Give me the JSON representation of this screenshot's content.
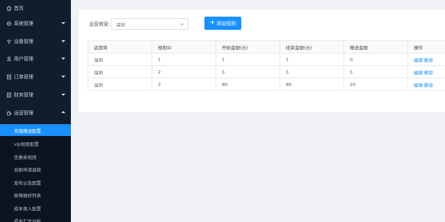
{
  "sidebar": {
    "items": [
      {
        "label": "首页",
        "icon": "home-icon",
        "caret": "none"
      },
      {
        "label": "系统管理",
        "icon": "gear-icon",
        "caret": "down"
      },
      {
        "label": "设备管理",
        "icon": "device-icon",
        "caret": "down"
      },
      {
        "label": "用户管理",
        "icon": "user-icon",
        "caret": "down"
      },
      {
        "label": "订单管理",
        "icon": "order-icon",
        "caret": "down"
      },
      {
        "label": "财务管理",
        "icon": "finance-icon",
        "caret": "down"
      },
      {
        "label": "运营管理",
        "icon": "operations-icon",
        "caret": "up"
      }
    ],
    "subitems": [
      {
        "label": "充值赠送配置",
        "active": true
      },
      {
        "label": "vip规则配置",
        "active": false
      },
      {
        "label": "优惠券规则",
        "active": false
      },
      {
        "label": "自助申请退款",
        "active": false
      },
      {
        "label": "发布公告配置",
        "active": false
      },
      {
        "label": "故障报修列表",
        "active": false
      },
      {
        "label": "成本录入配置",
        "active": false
      },
      {
        "label": "成本汇总分析",
        "active": false
      }
    ]
  },
  "filter": {
    "label": "运营商家:",
    "value": "深圳"
  },
  "add_button": {
    "label": "添加规则"
  },
  "table": {
    "headers": [
      "运营商",
      "规则ID",
      "开始金额(元)",
      "结束金额(元)",
      "赠送金额",
      "操作"
    ],
    "rows": [
      [
        "深圳",
        "1",
        "1",
        "1",
        "0"
      ],
      [
        "深圳",
        "2",
        "5",
        "5",
        "5"
      ],
      [
        "深圳",
        "3",
        "80",
        "80",
        "20"
      ]
    ],
    "actions": {
      "edit": "编辑",
      "delete": "删除"
    }
  },
  "colors": {
    "sidebar_bg": "#0f1d2e",
    "accent": "#1890ff",
    "page_bg": "#f0f2f5"
  }
}
